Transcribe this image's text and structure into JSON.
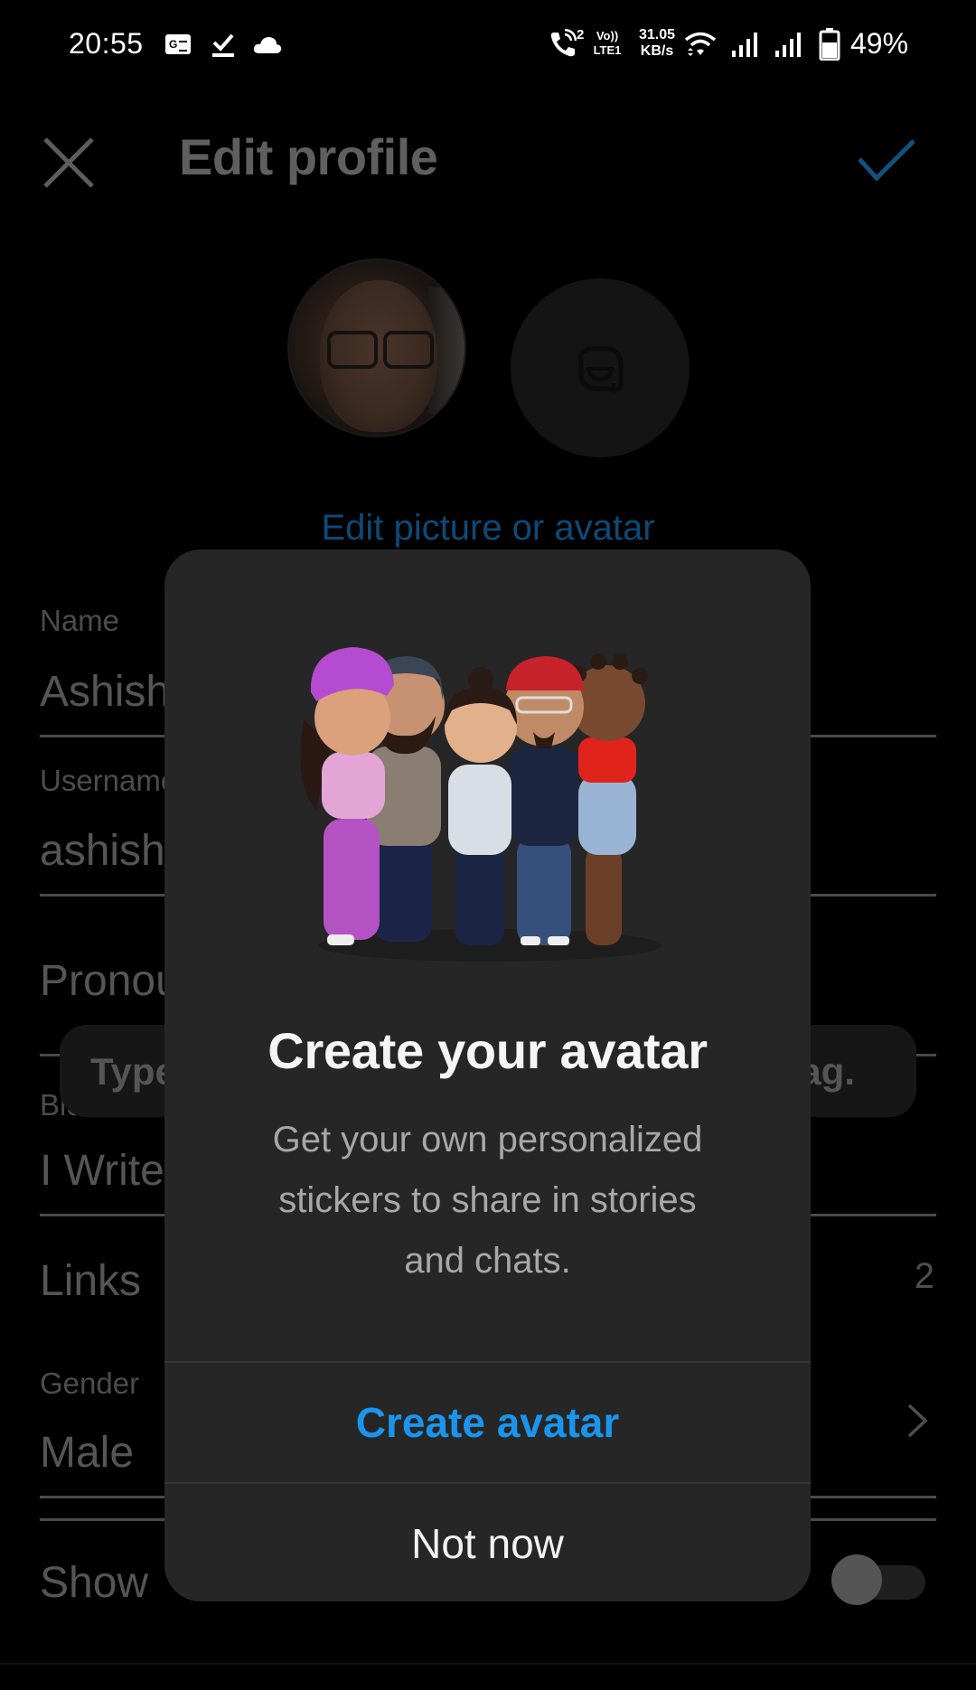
{
  "status_bar": {
    "time": "20:55",
    "left_icons": [
      "google-news-icon",
      "task-check-icon",
      "cloud-icon"
    ],
    "call_sim": "2",
    "volte_top": "Vo))",
    "volte_bottom": "LTE1",
    "net_speed_value": "31.05",
    "net_speed_unit": "KB/s",
    "right_icons": [
      "wifi-icon",
      "signal-sim1-icon",
      "signal-sim2-icon",
      "battery-icon"
    ],
    "battery_percent": "49%"
  },
  "header": {
    "title": "Edit profile",
    "close_icon": "close-icon",
    "save_icon": "checkmark-icon",
    "save_color": "#1a6fb0"
  },
  "profile": {
    "edit_picture_label": "Edit picture or avatar",
    "avatar_placeholder_icon": "avatar-sticker-icon"
  },
  "form": {
    "name_label": "Name",
    "name_value": "Ashish",
    "username_label": "Username",
    "username_value": "ashish",
    "pronouns_placeholder": "Pronouns",
    "bio_label": "Bio",
    "bio_value": "I Write",
    "links_label": "Links",
    "links_count": "2",
    "gender_label": "Gender",
    "gender_value": "Male",
    "show_label": "Show",
    "show_toggle_on": false
  },
  "toast": {
    "text_left": "Type",
    "text_right": "tag."
  },
  "dialog": {
    "illustration": "avatar-group-illustration",
    "title": "Create your avatar",
    "body_line1": "Get your own personalized",
    "body_line2": "stickers to share in stories",
    "body_line3": "and chats.",
    "primary_button": "Create avatar",
    "primary_color": "#1a95ee",
    "secondary_button": "Not now"
  }
}
